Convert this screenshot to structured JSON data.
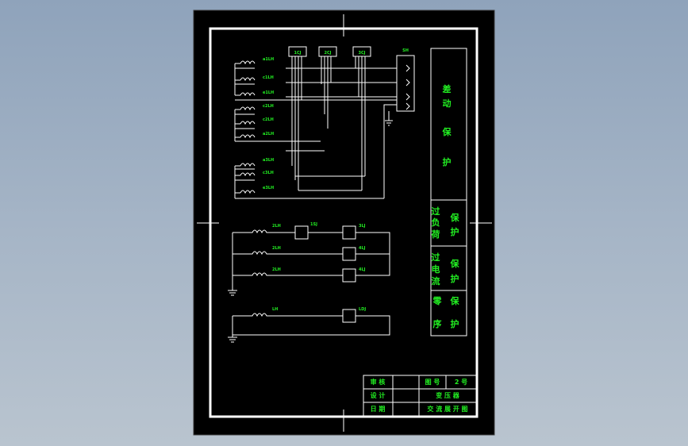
{
  "colors": {
    "background": "#8fa3bb",
    "sheet": "#000000",
    "line": "#ffffff",
    "text": "#22ee22"
  },
  "relays_top": [
    "1CJ",
    "2CJ",
    "3CJ"
  ],
  "switch_label": "SH",
  "ct_group1": [
    "a1LH",
    "c1LH",
    "e1LH"
  ],
  "ct_group2": [
    "c2LH",
    "c2LH",
    "a2LH"
  ],
  "ct_group3": [
    "a3LH",
    "c3LH",
    "e3LH"
  ],
  "protection_panel": {
    "diff": [
      "差",
      "动",
      "保",
      "护"
    ],
    "overload": [
      "过",
      "负",
      "荷",
      "保",
      "护"
    ],
    "overcurrent": [
      "过",
      "电",
      "流",
      "保",
      "护"
    ],
    "zero_seq": [
      "零",
      "序",
      "保",
      "护"
    ]
  },
  "lower_circuit": {
    "ct": [
      "2LH",
      "2LH",
      "2LH"
    ],
    "time_relay": "1SJ",
    "relays": [
      "3LJ",
      "4LJ",
      "4LJ"
    ],
    "zero_ct": "LH",
    "zero_relay": "LDJ"
  },
  "title_block": {
    "review": "审 核",
    "design": "设 计",
    "date": "日 期",
    "drawing_no_label": "图 号",
    "drawing_no": "2 号",
    "title_line1": "变 压 器",
    "title_line2": "交 流 展 开 图"
  }
}
